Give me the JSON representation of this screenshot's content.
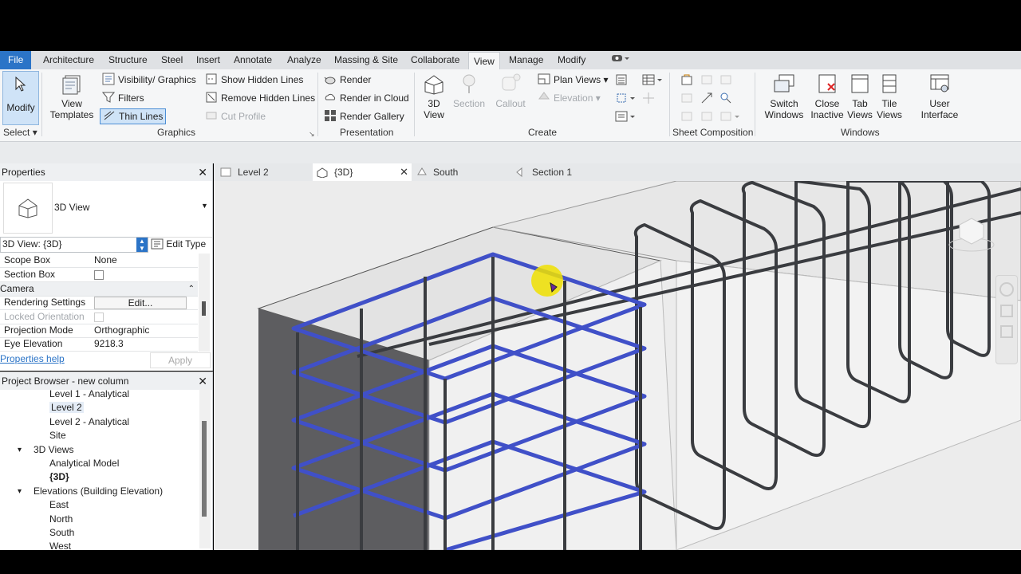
{
  "ribbon_tabs": [
    "File",
    "Architecture",
    "Structure",
    "Steel",
    "Insert",
    "Annotate",
    "Analyze",
    "Massing & Site",
    "Collaborate",
    "View",
    "Manage",
    "Modify"
  ],
  "modify": {
    "label": "Modify",
    "select": "Select"
  },
  "graphics": {
    "view_templates": "View Templates",
    "visibility": "Visibility/ Graphics",
    "filters": "Filters",
    "thin_lines": "Thin Lines",
    "show_hidden": "Show Hidden Lines",
    "remove_hidden": "Remove Hidden Lines",
    "cut_profile": "Cut Profile",
    "label": "Graphics"
  },
  "presentation": {
    "render": "Render",
    "render_cloud": "Render in Cloud",
    "render_gallery": "Render Gallery",
    "label": "Presentation"
  },
  "create": {
    "view3d": "3D View",
    "section": "Section",
    "callout": "Callout",
    "plan_views": "Plan Views",
    "elevation": "Elevation",
    "label": "Create"
  },
  "sheet": {
    "label": "Sheet Composition"
  },
  "windows": {
    "switch": "Switch Windows",
    "close_inactive": "Close Inactive",
    "tab_views": "Tab Views",
    "tile_views": "Tile Views",
    "user_interface": "User Interface",
    "label": "Windows"
  },
  "view_tabs": [
    "Level 2",
    "{3D}",
    "South",
    "Section 1"
  ],
  "properties": {
    "title": "Properties",
    "type_name": "3D View",
    "selector": "3D View: {3D}",
    "edit_type": "Edit Type",
    "rows": [
      {
        "k": "Scope Box",
        "v": "None"
      },
      {
        "k": "Section Box",
        "v": ""
      }
    ],
    "camera_header": "Camera",
    "rows2": [
      {
        "k": "Rendering Settings",
        "v": "Edit..."
      },
      {
        "k": "Locked Orientation",
        "v": ""
      },
      {
        "k": "Projection Mode",
        "v": "Orthographic"
      },
      {
        "k": "Eye Elevation",
        "v": "9218.3"
      }
    ],
    "help": "Properties help",
    "apply": "Apply"
  },
  "browser": {
    "title": "Project Browser - new column",
    "items": [
      {
        "t": "Level 1 - Analytical",
        "lvl": 2
      },
      {
        "t": "Level 2",
        "lvl": 2,
        "sel": true
      },
      {
        "t": "Level 2 - Analytical",
        "lvl": 2
      },
      {
        "t": "Site",
        "lvl": 2
      },
      {
        "t": "3D Views",
        "lvl": 1,
        "exp": true
      },
      {
        "t": "Analytical Model",
        "lvl": 2
      },
      {
        "t": "{3D}",
        "lvl": 2,
        "bold": true
      },
      {
        "t": "Elevations (Building Elevation)",
        "lvl": 1,
        "exp": true
      },
      {
        "t": "East",
        "lvl": 2
      },
      {
        "t": "North",
        "lvl": 2
      },
      {
        "t": "South",
        "lvl": 2
      },
      {
        "t": "West",
        "lvl": 2
      }
    ]
  },
  "colors": {
    "file_tab": "#2b74c7",
    "selected_rebar": "#4050c8",
    "rebar": "#3a3c40",
    "highlight": "#f0e000"
  }
}
